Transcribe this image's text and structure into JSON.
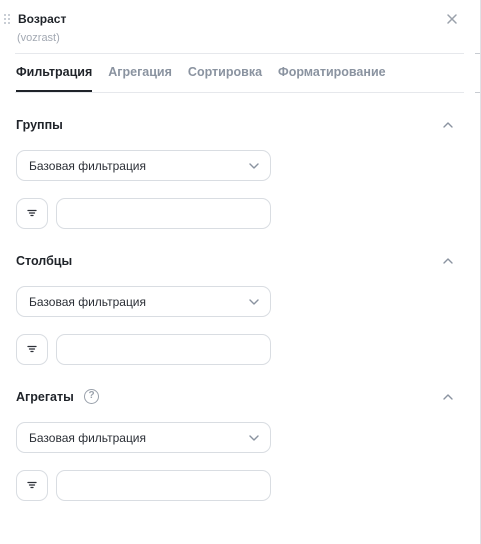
{
  "header": {
    "title": "Возраст",
    "subtitle": "(vozrast)",
    "close_icon": "close-icon",
    "drag_icon": "drag-handle-icon"
  },
  "tabs": [
    {
      "label": "Фильтрация",
      "active": true
    },
    {
      "label": "Агрегация",
      "active": false
    },
    {
      "label": "Сортировка",
      "active": false
    },
    {
      "label": "Форматирование",
      "active": false
    }
  ],
  "sections": [
    {
      "title": "Группы",
      "filter_type": "Базовая фильтрация",
      "value": "",
      "has_help": false,
      "expanded": true
    },
    {
      "title": "Столбцы",
      "filter_type": "Базовая фильтрация",
      "value": "",
      "has_help": false,
      "expanded": true
    },
    {
      "title": "Агрегаты",
      "filter_type": "Базовая фильтрация",
      "value": "",
      "has_help": true,
      "help_glyph": "?",
      "expanded": true
    }
  ],
  "colors": {
    "text_primary": "#1f2329",
    "text_muted": "#8a93a0",
    "border": "#d9dde2",
    "divider": "#e6e8ec"
  }
}
